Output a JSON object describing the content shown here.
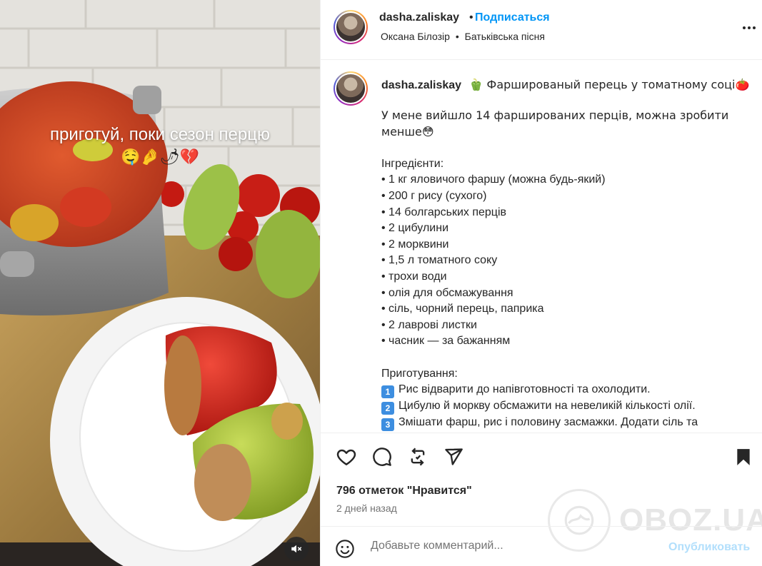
{
  "media": {
    "overlay_caption": "приготуй, поки сезон перцю",
    "overlay_emojis": "🤤🤌🌶💔",
    "mute_icon": "speaker-muted-icon"
  },
  "header": {
    "username": "dasha.zaliskay",
    "separator": "•",
    "follow_label": "Подписаться",
    "audio_artist": "Оксана Білозір",
    "audio_separator": "•",
    "audio_track": "Батьківська пісня"
  },
  "caption": {
    "username": "dasha.zaliskay",
    "title": "🫑 Фаршированый перець у томатному соці🍅",
    "lines": [
      "У мене вийшло 14 фаршированих перців, можна зробити",
      "менше😳",
      "",
      "Інгредієнти:",
      "• 1 кг яловичого фаршу (можна будь-який)",
      "• 200 г рису (сухого)",
      "• 14 болгарських перців",
      "• 2 цибулини",
      "• 2 морквини",
      "• 1,5 л томатного соку",
      "• трохи води",
      "• олія для обсмажування",
      "• сіль, чорний перець, паприка",
      "• 2 лаврові листки",
      "• часник — за бажанням",
      "",
      "Приготування:"
    ],
    "steps": [
      {
        "num": "1",
        "text": "Рис відварити до напівготовності та охолодити."
      },
      {
        "num": "2",
        "text": "Цибулю й моркву обсмажити на невеликій кількості олії."
      },
      {
        "num": "3",
        "text": "Змішати фарш, рис і половину засмажки. Додати сіль та"
      }
    ]
  },
  "actions": {
    "like_icon": "heart-icon",
    "comment_icon": "comment-icon",
    "repost_icon": "repost-icon",
    "share_icon": "send-icon",
    "save_icon": "bookmark-icon",
    "likes_text": "796 отметок \"Нравится\"",
    "time_text": "2 дней назад"
  },
  "watermark": {
    "text": "OBOZ.UA"
  },
  "comment": {
    "placeholder": "Добавьте комментарий...",
    "publish_label": "Опубликовать"
  },
  "colors": {
    "link": "#0095f6",
    "publish_disabled": "#b2dffc",
    "text": "#262626",
    "muted": "#737373"
  }
}
